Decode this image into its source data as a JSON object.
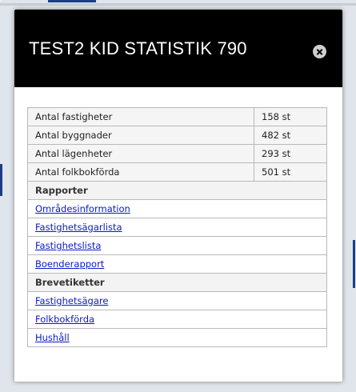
{
  "popup": {
    "title": "TEST2 KID STATISTIK 790",
    "close_icon": "close-circle-icon"
  },
  "stats": [
    {
      "label": "Antal fastigheter",
      "value": "158 st"
    },
    {
      "label": "Antal byggnader",
      "value": "482 st"
    },
    {
      "label": "Antal lägenheter",
      "value": "293 st"
    },
    {
      "label": "Antal folkbokförda",
      "value": "501 st"
    }
  ],
  "rapporter": {
    "heading": "Rapporter",
    "links": [
      "Områdesinformation",
      "Fastighetsägarlista",
      "Fastighetslista",
      "Boenderapport"
    ]
  },
  "brevetiketter": {
    "heading": "Brevetiketter",
    "links": [
      "Fastighetsägare",
      "Folkbokförda",
      "Hushåll"
    ]
  },
  "colors": {
    "header_bg": "#000000",
    "header_text": "#ffffff",
    "link": "#0b19c9"
  }
}
